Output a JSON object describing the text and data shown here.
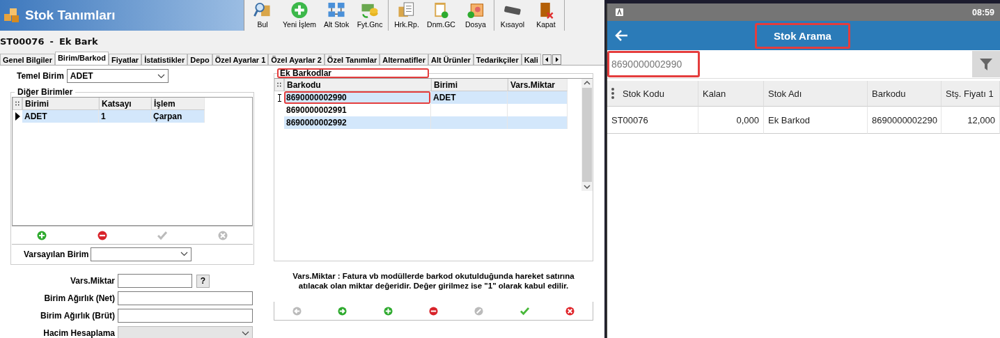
{
  "window": {
    "title": "Stok Tanımları"
  },
  "toolbar_groups": [
    {
      "buttons": [
        {
          "label": "Bul",
          "kind": "search"
        },
        {
          "label": "Yeni İşlem",
          "kind": "add"
        },
        {
          "label": "Alt Stok",
          "kind": "network"
        },
        {
          "label": "Fyt.Gnc",
          "kind": "money"
        }
      ]
    },
    {
      "buttons": [
        {
          "label": "Hrk.Rp.",
          "kind": "report"
        },
        {
          "label": "Dnm.GC",
          "kind": "document"
        },
        {
          "label": "Dosya",
          "kind": "folder"
        }
      ]
    },
    {
      "buttons": [
        {
          "label": "Kısayol",
          "kind": "keyboard"
        },
        {
          "label": "Kapat",
          "kind": "exit"
        }
      ]
    }
  ],
  "record": {
    "code": "ST00076",
    "separator": "-",
    "name": "Ek Bark"
  },
  "tabs": [
    {
      "label": "Genel Bilgiler",
      "selected": false
    },
    {
      "label": "Birim/Barkod",
      "selected": true
    },
    {
      "label": "Fiyatlar",
      "selected": false
    },
    {
      "label": "İstatistikler",
      "selected": false
    },
    {
      "label": "Depo",
      "selected": false
    },
    {
      "label": "Özel Ayarlar 1",
      "selected": false
    },
    {
      "label": "Özel Ayarlar 2",
      "selected": false
    },
    {
      "label": "Özel Tanımlar",
      "selected": false
    },
    {
      "label": "Alternatifler",
      "selected": false
    },
    {
      "label": "Alt Ürünler",
      "selected": false
    },
    {
      "label": "Tedarikçiler",
      "selected": false
    },
    {
      "label": "Kali",
      "selected": false
    }
  ],
  "units": {
    "base_unit": {
      "label": "Temel Birim",
      "value": "ADET"
    },
    "other_units": {
      "title": "Diğer Birimler",
      "corner_mark": "∷",
      "columns": [
        "Birimi",
        "Katsayı",
        "İşlem"
      ],
      "rows": [
        {
          "cells": [
            "ADET",
            "1",
            "Çarpan"
          ],
          "selected": true
        }
      ],
      "actions": [
        {
          "kind": "add",
          "disabled": false
        },
        {
          "kind": "remove",
          "disabled": false
        },
        {
          "kind": "confirm",
          "disabled": true
        },
        {
          "kind": "cancel",
          "disabled": true
        }
      ]
    },
    "default_unit": {
      "label": "Varsayılan Birim"
    },
    "fields": [
      {
        "label": "Vars.Miktar",
        "kind": "help",
        "help": "?"
      },
      {
        "label": "Birim Ağırlık (Net)",
        "kind": "text"
      },
      {
        "label": "Birim Ağırlık (Brüt)",
        "kind": "text"
      },
      {
        "label": "Hacim Hesaplama",
        "kind": "select",
        "disabled": true
      }
    ]
  },
  "barcodes": {
    "title": "Ek Barkodlar",
    "highlighted": true,
    "corner_mark": "∷",
    "columns": [
      "Barkodu",
      "Birimi",
      "Vars.Miktar"
    ],
    "rows": [
      {
        "cells": [
          "8690000002990",
          "ADET",
          ""
        ],
        "selected": true,
        "highlighted": true
      },
      {
        "cells": [
          "8690000002991",
          "",
          ""
        ],
        "selected": false,
        "highlighted": false
      },
      {
        "cells": [
          "8690000002992",
          "",
          ""
        ],
        "selected": false,
        "highlighted": false
      }
    ],
    "note": "Vars.Miktar : Fatura vb modüllerde barkod okutulduğunda hareket satırına atılacak olan miktar değeridir. Değer girilmez ise \"1\" olarak kabul edilir.",
    "actions": [
      {
        "kind": "back",
        "disabled": true
      },
      {
        "kind": "forward",
        "disabled": false
      },
      {
        "kind": "add",
        "disabled": false
      },
      {
        "kind": "remove",
        "disabled": false
      },
      {
        "kind": "edit",
        "disabled": true
      },
      {
        "kind": "confirm",
        "disabled": false
      },
      {
        "kind": "cancel",
        "disabled": false
      }
    ]
  },
  "mobile": {
    "status_time": "08:59",
    "title": "Stok Arama",
    "title_highlighted": true,
    "search": {
      "value": "8690000002990",
      "highlighted": true
    },
    "columns": [
      "Stok Kodu",
      "Kalan",
      "Stok Adı",
      "Barkodu",
      "Stş. Fiyatı 1"
    ],
    "rows": [
      {
        "cells": [
          "ST00076",
          "0,000",
          "Ek Barkod",
          "8690000002290",
          "12,000"
        ]
      }
    ]
  }
}
